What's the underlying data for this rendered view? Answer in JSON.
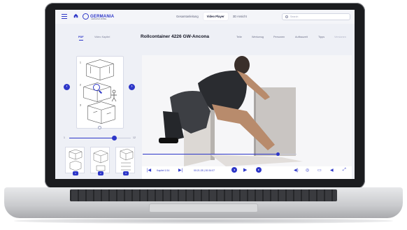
{
  "header": {
    "logo_text": "GERMANIA",
    "logo_sub": "GERMANIA MÖBEL",
    "nav_tabs": [
      "Gesamtanleitung",
      "Video Player",
      "3D Ansicht"
    ],
    "search_placeholder": "Search"
  },
  "subheader": {
    "left_tabs": [
      "PDF",
      "Video Kapitel"
    ],
    "title": "Rollcontainer 4226 GW-Ancona",
    "right_tabs": [
      "Teile",
      "Werkzeug",
      "Personen",
      "Aufbauzeit",
      "Tipps",
      "Versionen"
    ]
  },
  "pdf_panel": {
    "slider_min": "1",
    "slider_max": "12",
    "slider_fraction": 0.73,
    "thumbnail_labels": [
      "1",
      "2",
      "3"
    ]
  },
  "video": {
    "chapter_label": "Kapitel 1/14",
    "time": "00:21:28 | 00:34:07",
    "progress_fraction": 0.88
  },
  "colors": {
    "accent": "#2d36c8",
    "laptop_frame": "#1b1c1f"
  },
  "icons": [
    "menu-icon",
    "home-icon",
    "search-icon",
    "zoom-icon",
    "chevron-left-icon",
    "chevron-right-icon",
    "skip-back-icon",
    "skip-forward-icon",
    "play-icon",
    "volume-icon",
    "subtitles-icon",
    "fullscreen-icon"
  ]
}
